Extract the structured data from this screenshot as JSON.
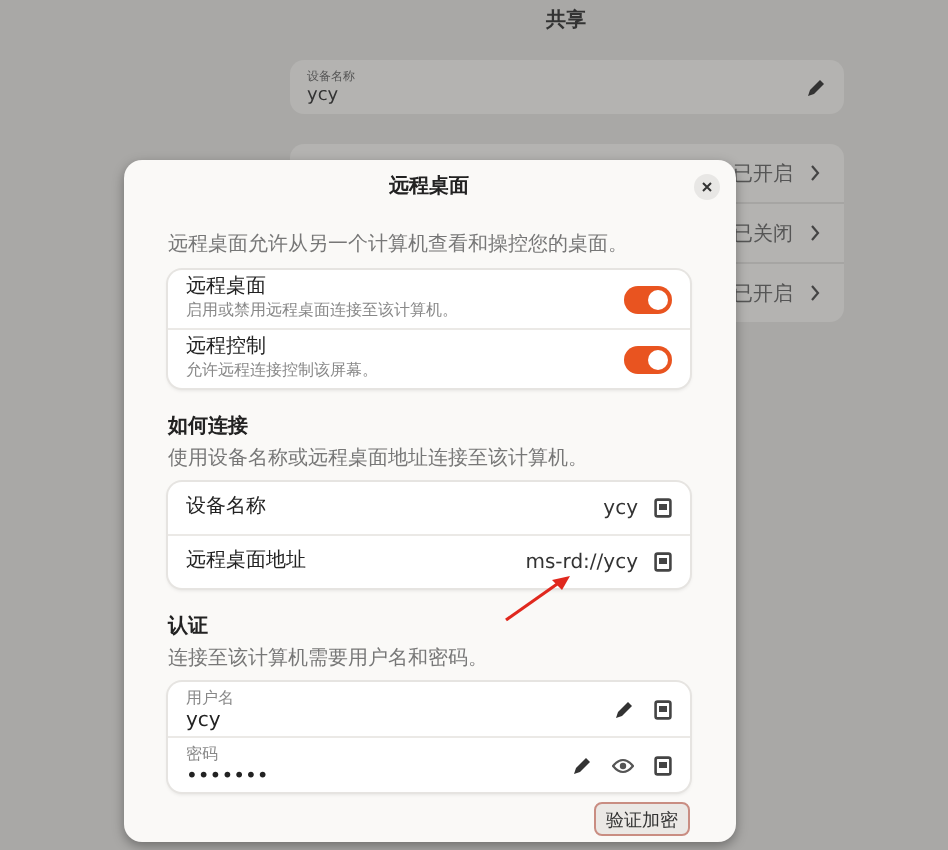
{
  "page_title": "共享",
  "device_name_field": {
    "label": "设备名称",
    "value": "ycy"
  },
  "services": [
    {
      "status": "已开启"
    },
    {
      "status": "已关闭"
    },
    {
      "status": "已开启"
    }
  ],
  "dialog": {
    "title": "远程桌面",
    "description": "远程桌面允许从另一个计算机查看和操控您的桌面。",
    "switches": [
      {
        "label": "远程桌面",
        "description": "启用或禁用远程桌面连接至该计算机。",
        "on": true
      },
      {
        "label": "远程控制",
        "description": "允许远程连接控制该屏幕。",
        "on": true
      }
    ],
    "connect": {
      "heading": "如何连接",
      "description": "使用设备名称或远程桌面地址连接至该计算机。",
      "rows": [
        {
          "label": "设备名称",
          "value": "ycy"
        },
        {
          "label": "远程桌面地址",
          "value": "ms-rd://ycy"
        }
      ]
    },
    "auth": {
      "heading": "认证",
      "description": "连接至该计算机需要用户名和密码。",
      "fields": [
        {
          "kind": "text",
          "label": "用户名",
          "value": "ycy"
        },
        {
          "kind": "password",
          "label": "密码",
          "value": "•••••••"
        }
      ]
    },
    "button": "验证加密"
  }
}
